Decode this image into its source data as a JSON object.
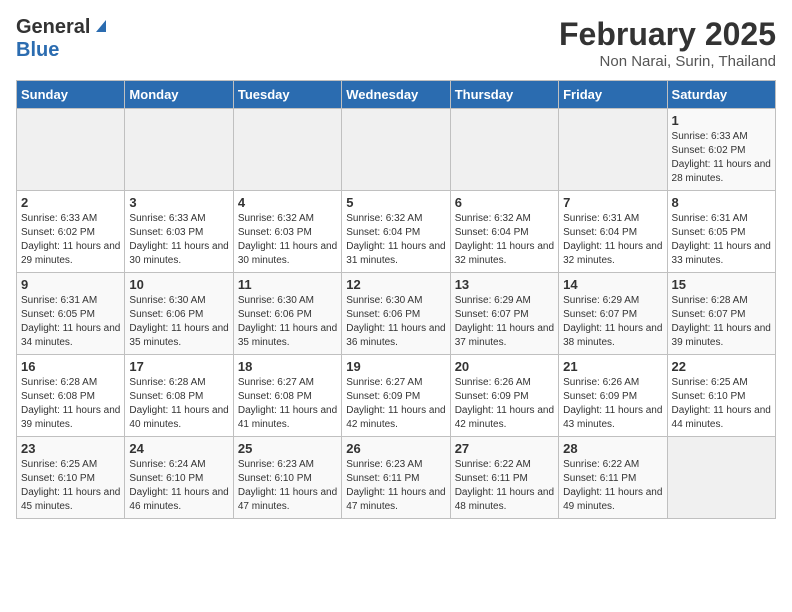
{
  "header": {
    "logo_general": "General",
    "logo_blue": "Blue",
    "title": "February 2025",
    "subtitle": "Non Narai, Surin, Thailand"
  },
  "calendar": {
    "days_of_week": [
      "Sunday",
      "Monday",
      "Tuesday",
      "Wednesday",
      "Thursday",
      "Friday",
      "Saturday"
    ],
    "weeks": [
      [
        {
          "day": "",
          "info": ""
        },
        {
          "day": "",
          "info": ""
        },
        {
          "day": "",
          "info": ""
        },
        {
          "day": "",
          "info": ""
        },
        {
          "day": "",
          "info": ""
        },
        {
          "day": "",
          "info": ""
        },
        {
          "day": "1",
          "info": "Sunrise: 6:33 AM\nSunset: 6:02 PM\nDaylight: 11 hours and 28 minutes."
        }
      ],
      [
        {
          "day": "2",
          "info": "Sunrise: 6:33 AM\nSunset: 6:02 PM\nDaylight: 11 hours and 29 minutes."
        },
        {
          "day": "3",
          "info": "Sunrise: 6:33 AM\nSunset: 6:03 PM\nDaylight: 11 hours and 30 minutes."
        },
        {
          "day": "4",
          "info": "Sunrise: 6:32 AM\nSunset: 6:03 PM\nDaylight: 11 hours and 30 minutes."
        },
        {
          "day": "5",
          "info": "Sunrise: 6:32 AM\nSunset: 6:04 PM\nDaylight: 11 hours and 31 minutes."
        },
        {
          "day": "6",
          "info": "Sunrise: 6:32 AM\nSunset: 6:04 PM\nDaylight: 11 hours and 32 minutes."
        },
        {
          "day": "7",
          "info": "Sunrise: 6:31 AM\nSunset: 6:04 PM\nDaylight: 11 hours and 32 minutes."
        },
        {
          "day": "8",
          "info": "Sunrise: 6:31 AM\nSunset: 6:05 PM\nDaylight: 11 hours and 33 minutes."
        }
      ],
      [
        {
          "day": "9",
          "info": "Sunrise: 6:31 AM\nSunset: 6:05 PM\nDaylight: 11 hours and 34 minutes."
        },
        {
          "day": "10",
          "info": "Sunrise: 6:30 AM\nSunset: 6:06 PM\nDaylight: 11 hours and 35 minutes."
        },
        {
          "day": "11",
          "info": "Sunrise: 6:30 AM\nSunset: 6:06 PM\nDaylight: 11 hours and 35 minutes."
        },
        {
          "day": "12",
          "info": "Sunrise: 6:30 AM\nSunset: 6:06 PM\nDaylight: 11 hours and 36 minutes."
        },
        {
          "day": "13",
          "info": "Sunrise: 6:29 AM\nSunset: 6:07 PM\nDaylight: 11 hours and 37 minutes."
        },
        {
          "day": "14",
          "info": "Sunrise: 6:29 AM\nSunset: 6:07 PM\nDaylight: 11 hours and 38 minutes."
        },
        {
          "day": "15",
          "info": "Sunrise: 6:28 AM\nSunset: 6:07 PM\nDaylight: 11 hours and 39 minutes."
        }
      ],
      [
        {
          "day": "16",
          "info": "Sunrise: 6:28 AM\nSunset: 6:08 PM\nDaylight: 11 hours and 39 minutes."
        },
        {
          "day": "17",
          "info": "Sunrise: 6:28 AM\nSunset: 6:08 PM\nDaylight: 11 hours and 40 minutes."
        },
        {
          "day": "18",
          "info": "Sunrise: 6:27 AM\nSunset: 6:08 PM\nDaylight: 11 hours and 41 minutes."
        },
        {
          "day": "19",
          "info": "Sunrise: 6:27 AM\nSunset: 6:09 PM\nDaylight: 11 hours and 42 minutes."
        },
        {
          "day": "20",
          "info": "Sunrise: 6:26 AM\nSunset: 6:09 PM\nDaylight: 11 hours and 42 minutes."
        },
        {
          "day": "21",
          "info": "Sunrise: 6:26 AM\nSunset: 6:09 PM\nDaylight: 11 hours and 43 minutes."
        },
        {
          "day": "22",
          "info": "Sunrise: 6:25 AM\nSunset: 6:10 PM\nDaylight: 11 hours and 44 minutes."
        }
      ],
      [
        {
          "day": "23",
          "info": "Sunrise: 6:25 AM\nSunset: 6:10 PM\nDaylight: 11 hours and 45 minutes."
        },
        {
          "day": "24",
          "info": "Sunrise: 6:24 AM\nSunset: 6:10 PM\nDaylight: 11 hours and 46 minutes."
        },
        {
          "day": "25",
          "info": "Sunrise: 6:23 AM\nSunset: 6:10 PM\nDaylight: 11 hours and 47 minutes."
        },
        {
          "day": "26",
          "info": "Sunrise: 6:23 AM\nSunset: 6:11 PM\nDaylight: 11 hours and 47 minutes."
        },
        {
          "day": "27",
          "info": "Sunrise: 6:22 AM\nSunset: 6:11 PM\nDaylight: 11 hours and 48 minutes."
        },
        {
          "day": "28",
          "info": "Sunrise: 6:22 AM\nSunset: 6:11 PM\nDaylight: 11 hours and 49 minutes."
        },
        {
          "day": "",
          "info": ""
        }
      ]
    ]
  }
}
